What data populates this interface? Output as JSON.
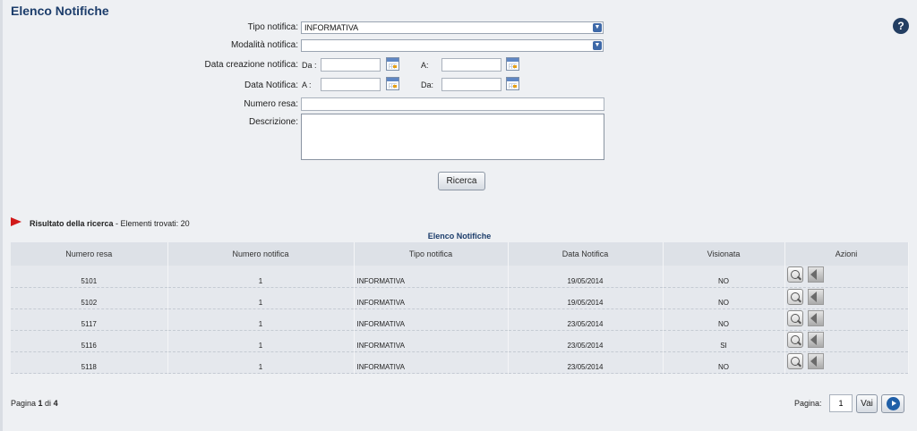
{
  "page": {
    "title": "Elenco Notifiche"
  },
  "form": {
    "tipo_label": "Tipo notifica:",
    "tipo_value": "INFORMATIVA",
    "modalita_label": "Modalità notifica:",
    "modalita_value": "",
    "data_creazione_label": "Data creazione notifica:",
    "data_creazione_from_label": "Da :",
    "data_creazione_to_label": "A:",
    "data_notifica_label": "Data Notifica:",
    "data_notifica_first_label": "A :",
    "data_notifica_second_label": "Da:",
    "numero_resa_label": "Numero resa:",
    "descrizione_label": "Descrizione:",
    "search_button": "Ricerca"
  },
  "results": {
    "title": "Risultato della ricerca",
    "count_text": " - Elementi trovati: 20",
    "caption": "Elenco Notifiche",
    "columns": [
      "Numero resa",
      "Numero notifica",
      "Tipo notifica",
      "Data Notifica",
      "Visionata",
      "Azioni"
    ],
    "rows": [
      {
        "numero_resa": "5101",
        "numero_notifica": "1",
        "tipo": "INFORMATIVA",
        "data": "19/05/2014",
        "visionata": "NO"
      },
      {
        "numero_resa": "5102",
        "numero_notifica": "1",
        "tipo": "INFORMATIVA",
        "data": "19/05/2014",
        "visionata": "NO"
      },
      {
        "numero_resa": "5117",
        "numero_notifica": "1",
        "tipo": "INFORMATIVA",
        "data": "23/05/2014",
        "visionata": "NO"
      },
      {
        "numero_resa": "5116",
        "numero_notifica": "1",
        "tipo": "INFORMATIVA",
        "data": "23/05/2014",
        "visionata": "SI"
      },
      {
        "numero_resa": "5118",
        "numero_notifica": "1",
        "tipo": "INFORMATIVA",
        "data": "23/05/2014",
        "visionata": "NO"
      }
    ]
  },
  "pager": {
    "prefix": "Pagina ",
    "current": "1",
    "middle": " di ",
    "total": "4",
    "label": "Pagina:",
    "input_value": "1",
    "go_button": "Vai"
  },
  "icons": {
    "help": "help-icon",
    "calendar": "calendar-icon",
    "view": "view-icon",
    "back": "back-icon",
    "next": "next-page-icon",
    "result_marker": "red-arrow-icon"
  },
  "colors": {
    "title": "#1c3d6b",
    "background": "#eef0f3",
    "table": "#e5e8ed",
    "marker": "#d11a1a"
  }
}
